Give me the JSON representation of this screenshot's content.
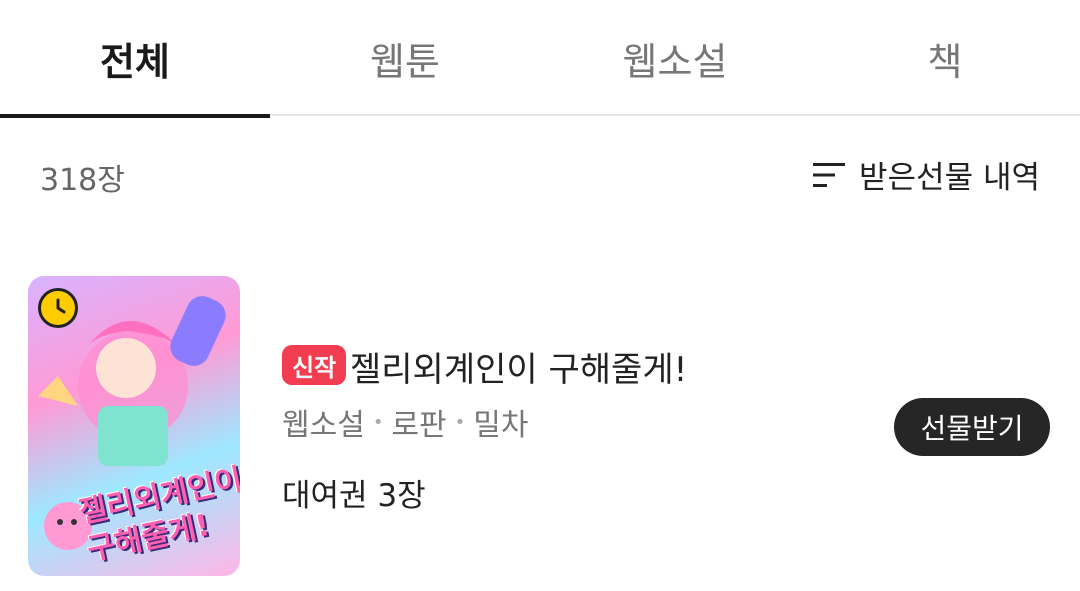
{
  "tabs": [
    {
      "label": "전체",
      "active": true
    },
    {
      "label": "웹툰",
      "active": false
    },
    {
      "label": "웹소설",
      "active": false
    },
    {
      "label": "책",
      "active": false
    }
  ],
  "summary": {
    "count": "318장",
    "history_label": "받은선물 내역",
    "history_icon": "list-sort-icon"
  },
  "items": [
    {
      "badge": "신작",
      "badge_color": "#f23c4f",
      "title": "젤리외계인이 구해줄게!",
      "tags": [
        "웹소설",
        "로판",
        "밀차"
      ],
      "rental": "대여권 3장",
      "gift_label": "선물받기",
      "cover_icon": "clock-icon",
      "cover_title_art": "젤리외계인이 구해줄게!"
    }
  ]
}
